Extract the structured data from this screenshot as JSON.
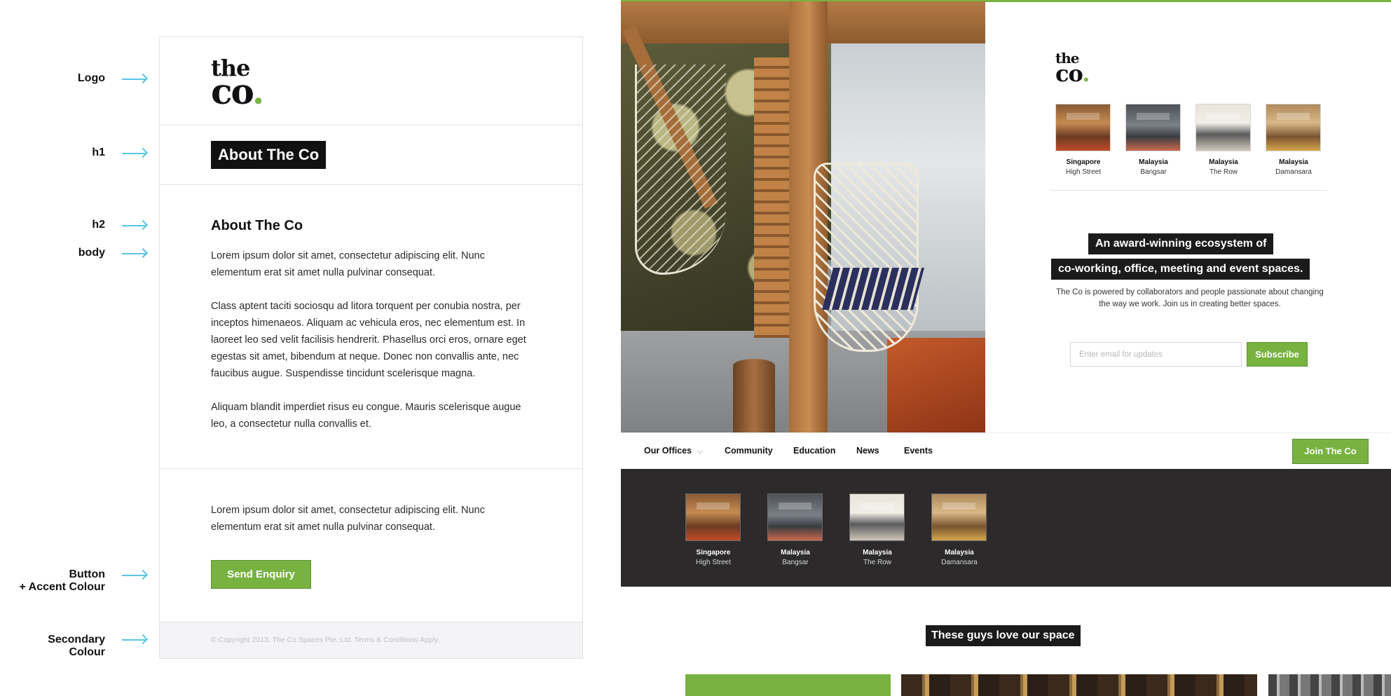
{
  "annotations": {
    "logo": "Logo",
    "h1": "h1",
    "h2": "h2",
    "body": "body",
    "button_line1": "Button",
    "button_line2": "+ Accent Colour",
    "secondary_line1": "Secondary",
    "secondary_line2": "Colour"
  },
  "style_guide": {
    "logo_line1": "the",
    "logo_line2": "co",
    "logo_dot": ".",
    "h1": "About The Co",
    "h2": "About The Co",
    "para1": "Lorem ipsum dolor sit amet, consectetur adipiscing elit. Nunc elementum erat sit amet nulla pulvinar consequat.",
    "para2": "Class aptent taciti sociosqu ad litora torquent per conubia nostra, per inceptos himenaeos. Aliquam ac vehicula eros, nec elementum est. In laoreet leo sed velit facilisis hendrerit. Phasellus orci eros, ornare eget egestas sit amet, bibendum at neque. Donec non convallis ante, nec faucibus augue. Suspendisse tincidunt scelerisque magna.",
    "para3": "Aliquam blandit imperdiet risus eu congue. Mauris scelerisque augue leo, a consectetur nulla convallis et.",
    "para4": "Lorem ipsum dolor sit amet, consectetur adipiscing elit. Nunc elementum erat sit amet nulla pulvinar consequat.",
    "button": "Send Enquiry",
    "footer": "© Copyright 2013. The Co Spaces Pte. Ltd. Terms & Conditions Apply."
  },
  "site": {
    "logo_line1": "the",
    "logo_line2": "co",
    "logo_dot": ".",
    "locations": [
      {
        "country": "Singapore",
        "place": "High Street"
      },
      {
        "country": "Malaysia",
        "place": "Bangsar"
      },
      {
        "country": "Malaysia",
        "place": "The Row"
      },
      {
        "country": "Malaysia",
        "place": "Damansara"
      }
    ],
    "tagline1": "An award-winning ecosystem of",
    "tagline2": "co-working, office, meeting and event spaces.",
    "hero_body": "The Co is powered by collaborators and people passionate about changing the way we work. Join us in creating better spaces.",
    "email_placeholder": "Enter email for updates",
    "subscribe": "Subscribe",
    "nav": {
      "offices": "Our Offices",
      "offices_chevron": "⌵",
      "community": "Community",
      "education": "Education",
      "news": "News",
      "events": "Events",
      "join": "Join The Co"
    },
    "testimonials_title": "These guys love our space"
  },
  "colors": {
    "accent": "#78b241",
    "secondary": "#f4f4f6",
    "dark_band": "#2c2a2b",
    "annotation_arrow": "#58c4e6"
  }
}
